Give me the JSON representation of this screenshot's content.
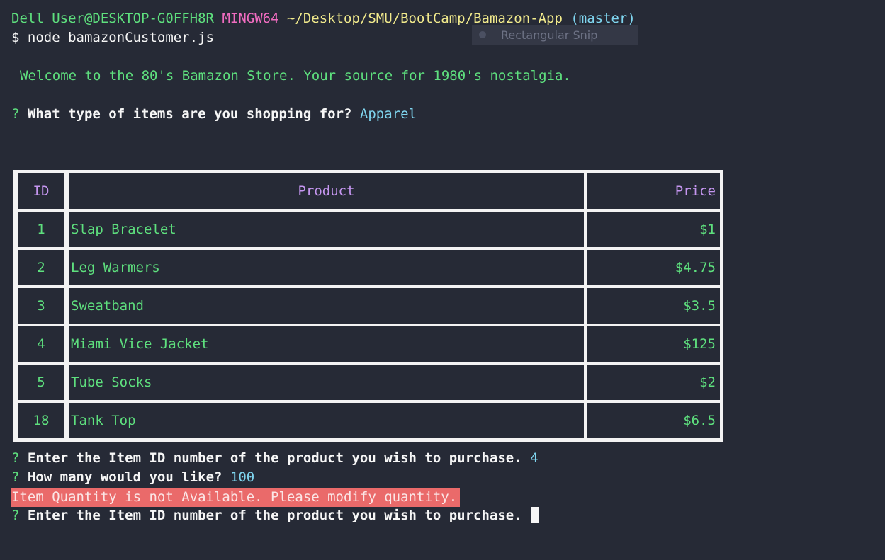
{
  "prompt": {
    "user_host": "Dell User@DESKTOP-G0FFH8R",
    "shell": "MINGW64",
    "path": "~/Desktop/SMU/BootCamp/Bamazon-App",
    "branch": "(master)",
    "dollar": "$",
    "command": "node bamazonCustomer.js"
  },
  "snip_overlay": {
    "icon": "radio-dot-icon",
    "label": "Rectangular Snip"
  },
  "welcome": "Welcome to the 80's Bamazon Store. Your source for 1980's nostalgia.",
  "question_mark": "?",
  "q_category": {
    "text": "What type of items are you shopping for?",
    "answer": "Apparel"
  },
  "table": {
    "headers": [
      "ID",
      "Product",
      "Price"
    ],
    "rows": [
      [
        "1",
        "Slap Bracelet",
        "$1"
      ],
      [
        "2",
        "Leg Warmers",
        "$4.75"
      ],
      [
        "3",
        "Sweatband",
        "$3.5"
      ],
      [
        "4",
        "Miami Vice Jacket",
        "$125"
      ],
      [
        "5",
        "Tube Socks",
        "$2"
      ],
      [
        "18",
        "Tank Top",
        "$6.5"
      ]
    ]
  },
  "q_item": {
    "text": "Enter the Item ID number of the product you wish to purchase.",
    "answer": "4"
  },
  "q_qty": {
    "text": "How many would you like?",
    "answer": "100"
  },
  "error_message": "Item Quantity is not Available. Please modify quantity.",
  "q_item_again": {
    "text": "Enter the Item ID number of the product you wish to purchase."
  },
  "colors": {
    "background": "#262a36",
    "green": "#5ee07e",
    "magenta": "#f06cc0",
    "yellow": "#f1ea8c",
    "cyan": "#7fd5ef",
    "header_purple": "#c596f0",
    "error_bg": "#ea6a6a"
  }
}
